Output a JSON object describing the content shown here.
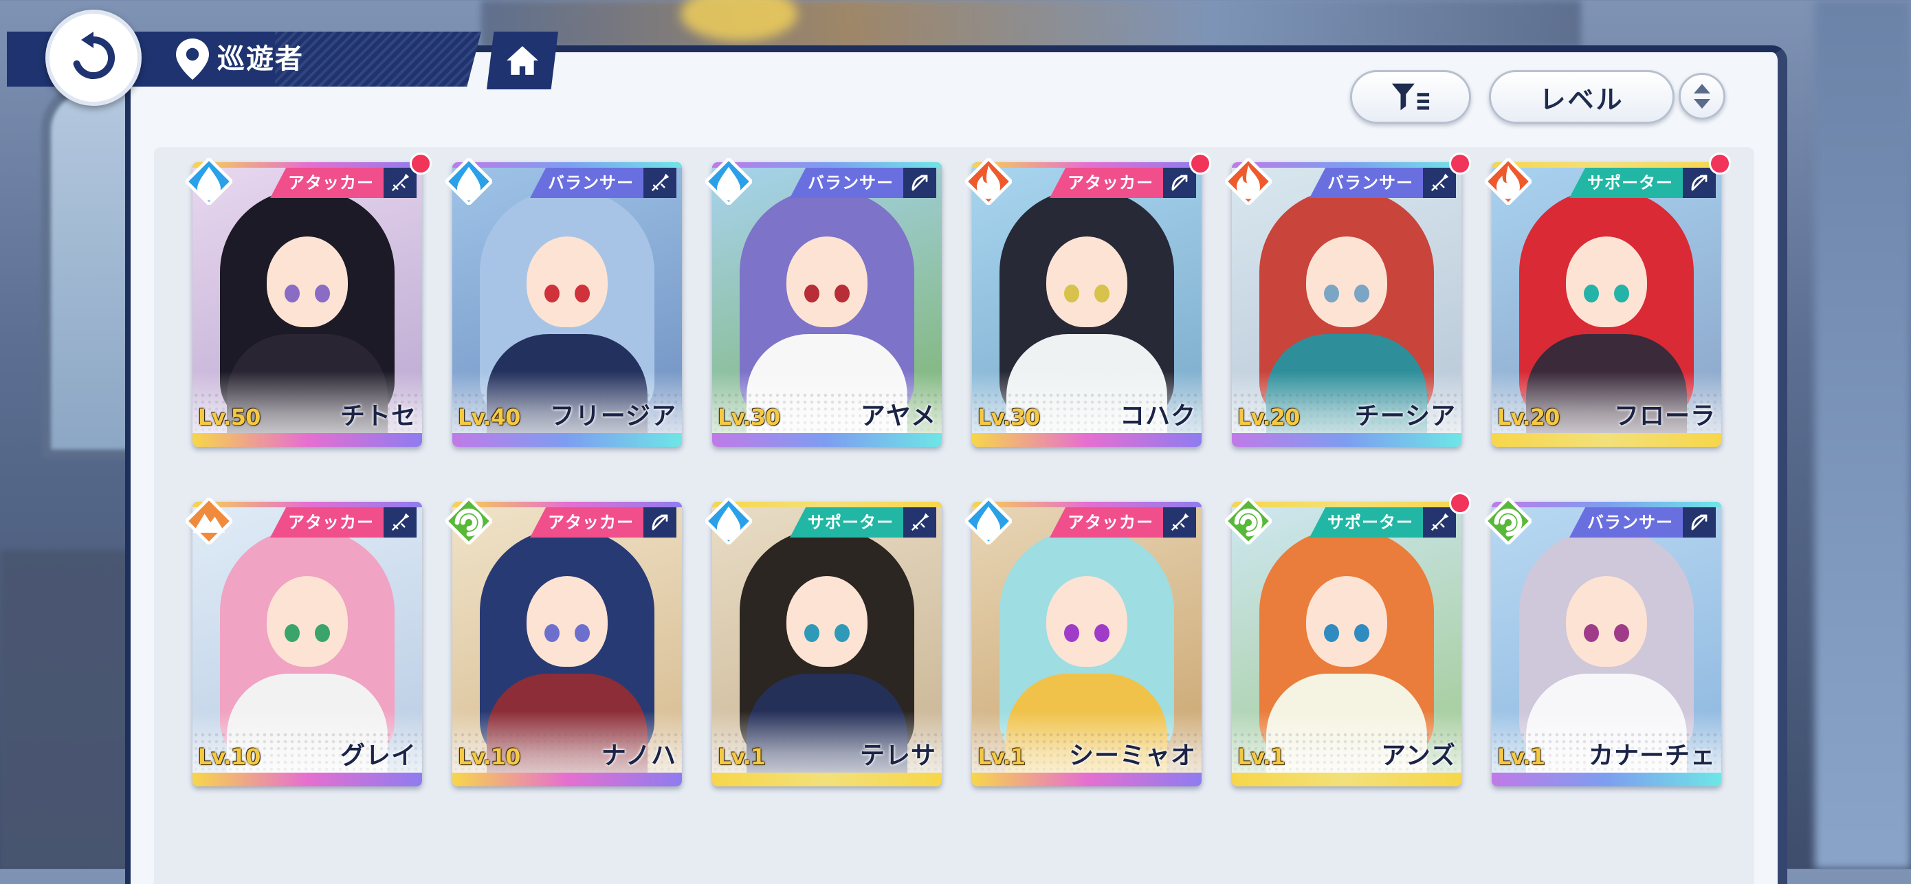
{
  "header": {
    "title": "巡遊者"
  },
  "sort": {
    "label": "レベル"
  },
  "colors": {
    "attacker": "#f04f8b",
    "balancer": "#6a6fe0",
    "supporter": "#22b7a4",
    "water": "#2aa0e8",
    "fire": "#ef5a2c",
    "wind": "#58b83a",
    "earth": "#f08a3c"
  },
  "characters": [
    {
      "name": "チトセ",
      "level": "Lv.50",
      "role": "アタッカー",
      "element": "water",
      "weapon": "sword-icon",
      "new": true
    },
    {
      "name": "フリージア",
      "level": "Lv.40",
      "role": "バランサー",
      "element": "water",
      "weapon": "sword-icon",
      "new": false
    },
    {
      "name": "アヤメ",
      "level": "Lv.30",
      "role": "バランサー",
      "element": "water",
      "weapon": "bow-icon",
      "new": false
    },
    {
      "name": "コハク",
      "level": "Lv.30",
      "role": "アタッカー",
      "element": "fire",
      "weapon": "bow-icon",
      "new": true
    },
    {
      "name": "チーシア",
      "level": "Lv.20",
      "role": "バランサー",
      "element": "fire",
      "weapon": "sword-icon",
      "new": true
    },
    {
      "name": "フローラ",
      "level": "Lv.20",
      "role": "サポーター",
      "element": "fire",
      "weapon": "bow-icon",
      "new": true
    },
    {
      "name": "グレイ",
      "level": "Lv.10",
      "role": "アタッカー",
      "element": "earth",
      "weapon": "sword-icon",
      "new": false
    },
    {
      "name": "ナノハ",
      "level": "Lv.10",
      "role": "アタッカー",
      "element": "wind",
      "weapon": "bow-icon",
      "new": false
    },
    {
      "name": "テレサ",
      "level": "Lv.1",
      "role": "サポーター",
      "element": "water",
      "weapon": "sword-icon",
      "new": false
    },
    {
      "name": "シーミャオ",
      "level": "Lv.1",
      "role": "アタッカー",
      "element": "water",
      "weapon": "sword-icon",
      "new": false
    },
    {
      "name": "アンズ",
      "level": "Lv.1",
      "role": "サポーター",
      "element": "wind",
      "weapon": "sword-icon",
      "new": true
    },
    {
      "name": "カナーチェ",
      "level": "Lv.1",
      "role": "バランサー",
      "element": "wind",
      "weapon": "bow-icon",
      "new": false
    }
  ]
}
